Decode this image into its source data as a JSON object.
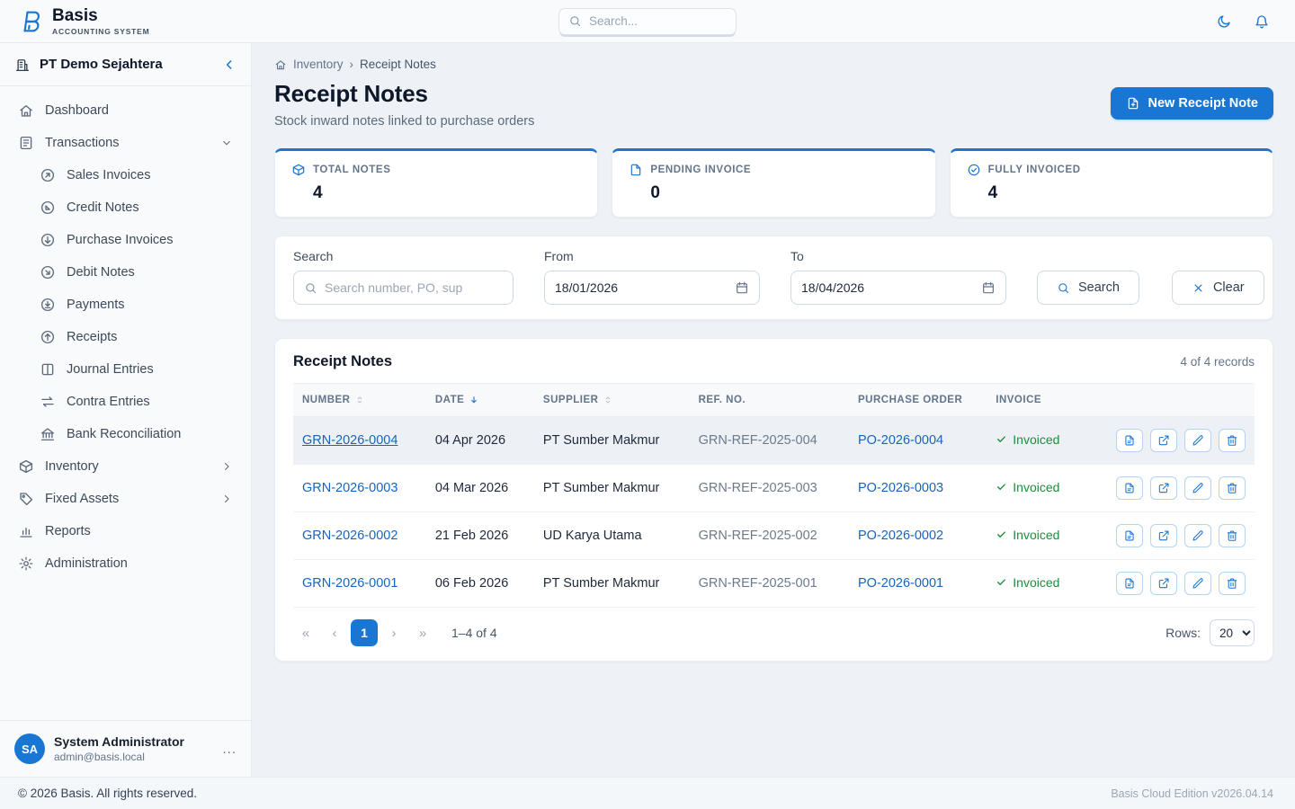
{
  "topbar": {
    "brand": "Basis",
    "brand_subtitle": "ACCOUNTING SYSTEM",
    "search_placeholder": "Search..."
  },
  "sidebar": {
    "company": "PT Demo Sejahtera",
    "items": [
      {
        "label": "Dashboard"
      },
      {
        "label": "Transactions"
      },
      {
        "label": "Sales Invoices"
      },
      {
        "label": "Credit Notes"
      },
      {
        "label": "Purchase Invoices"
      },
      {
        "label": "Debit Notes"
      },
      {
        "label": "Payments"
      },
      {
        "label": "Receipts"
      },
      {
        "label": "Journal Entries"
      },
      {
        "label": "Contra Entries"
      },
      {
        "label": "Bank Reconciliation"
      },
      {
        "label": "Inventory"
      },
      {
        "label": "Fixed Assets"
      },
      {
        "label": "Reports"
      },
      {
        "label": "Administration"
      }
    ],
    "user": {
      "initials": "SA",
      "name": "System Administrator",
      "email": "admin@basis.local",
      "menu_label": "..."
    }
  },
  "breadcrumb": {
    "section": "Inventory",
    "separator": "›",
    "current": "Receipt Notes"
  },
  "page": {
    "title": "Receipt Notes",
    "subtitle": "Stock inward notes linked to purchase orders",
    "new_button_label": "New Receipt Note"
  },
  "stats": [
    {
      "label": "TOTAL NOTES",
      "value": "4"
    },
    {
      "label": "PENDING INVOICE",
      "value": "0"
    },
    {
      "label": "FULLY INVOICED",
      "value": "4"
    }
  ],
  "filters": {
    "search_label": "Search",
    "search_placeholder": "Search number, PO, sup",
    "from_label": "From",
    "from_value": "18/01/2026",
    "to_label": "To",
    "to_value": "18/04/2026",
    "search_button_label": "Search",
    "clear_button_label": "Clear"
  },
  "table": {
    "title": "Receipt Notes",
    "records_summary": "4 of 4 records",
    "columns": {
      "number": "NUMBER",
      "date": "DATE",
      "supplier": "SUPPLIER",
      "ref_no": "REF. NO.",
      "purchase_order": "PURCHASE ORDER",
      "invoice": "INVOICE"
    },
    "rows": [
      {
        "number": "GRN-2026-0004",
        "date": "04 Apr 2026",
        "supplier": "PT Sumber Makmur",
        "ref_no": "GRN-REF-2025-004",
        "purchase_order": "PO-2026-0004",
        "invoice_status": "Invoiced"
      },
      {
        "number": "GRN-2026-0003",
        "date": "04 Mar 2026",
        "supplier": "PT Sumber Makmur",
        "ref_no": "GRN-REF-2025-003",
        "purchase_order": "PO-2026-0003",
        "invoice_status": "Invoiced"
      },
      {
        "number": "GRN-2026-0002",
        "date": "21 Feb 2026",
        "supplier": "UD Karya Utama",
        "ref_no": "GRN-REF-2025-002",
        "purchase_order": "PO-2026-0002",
        "invoice_status": "Invoiced"
      },
      {
        "number": "GRN-2026-0001",
        "date": "06 Feb 2026",
        "supplier": "PT Sumber Makmur",
        "ref_no": "GRN-REF-2025-001",
        "purchase_order": "PO-2026-0001",
        "invoice_status": "Invoiced"
      }
    ],
    "pagination": {
      "first": "«",
      "prev": "‹",
      "page": "1",
      "next": "›",
      "last": "»",
      "range": "1–4 of 4",
      "rows_label": "Rows:",
      "rows_value": "20"
    }
  },
  "footer": {
    "left": "© 2026 Basis. All rights reserved.",
    "right": "Basis Cloud Edition v2026.04.14"
  },
  "colors": {
    "primary": "#1976d2",
    "link": "#1565c0",
    "success": "#1e8e3e"
  }
}
